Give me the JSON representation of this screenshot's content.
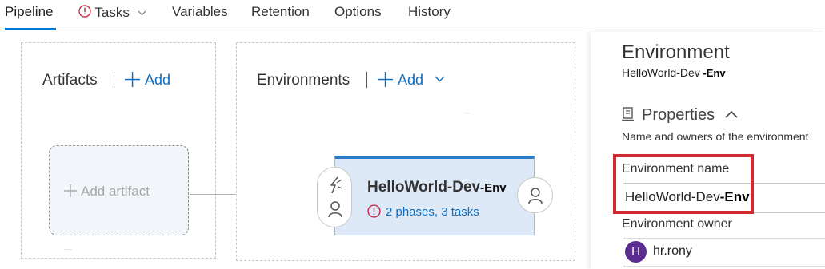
{
  "tabs": {
    "pipeline": "Pipeline",
    "tasks": "Tasks",
    "variables": "Variables",
    "retention": "Retention",
    "options": "Options",
    "history": "History"
  },
  "canvas": {
    "artifacts_header": "Artifacts",
    "artifacts_add": "Add",
    "environments_header": "Environments",
    "environments_add": "Add",
    "add_artifact": "Add artifact"
  },
  "environment_card": {
    "name_base": "HelloWorld-Dev",
    "name_suffix": "-Env",
    "status": "2 phases, 3 tasks"
  },
  "pane": {
    "title": "Environment",
    "subtitle_base": "HelloWorld-Dev",
    "subtitle_suffix": " -Env",
    "section_title": "Properties",
    "section_desc": "Name and owners of the environment",
    "name_label": "Environment name",
    "name_value_base": "HelloWorld-Dev",
    "name_value_suffix": "-Env",
    "owner_label": "Environment owner",
    "owner_initial": "H",
    "owner_name": "hr.rony"
  },
  "colors": {
    "accent": "#0078d4",
    "link": "#106ebe",
    "warning": "#c4314b",
    "highlight": "#d32a2f",
    "avatar": "#5c2d91"
  },
  "icons": {
    "tasks_tab": "warning-circle-icon",
    "add": "plus-icon",
    "pre_deployment": [
      "trigger-lightning-icon",
      "user-icon"
    ],
    "post_deployment": "user-icon",
    "properties": "document-icon"
  }
}
